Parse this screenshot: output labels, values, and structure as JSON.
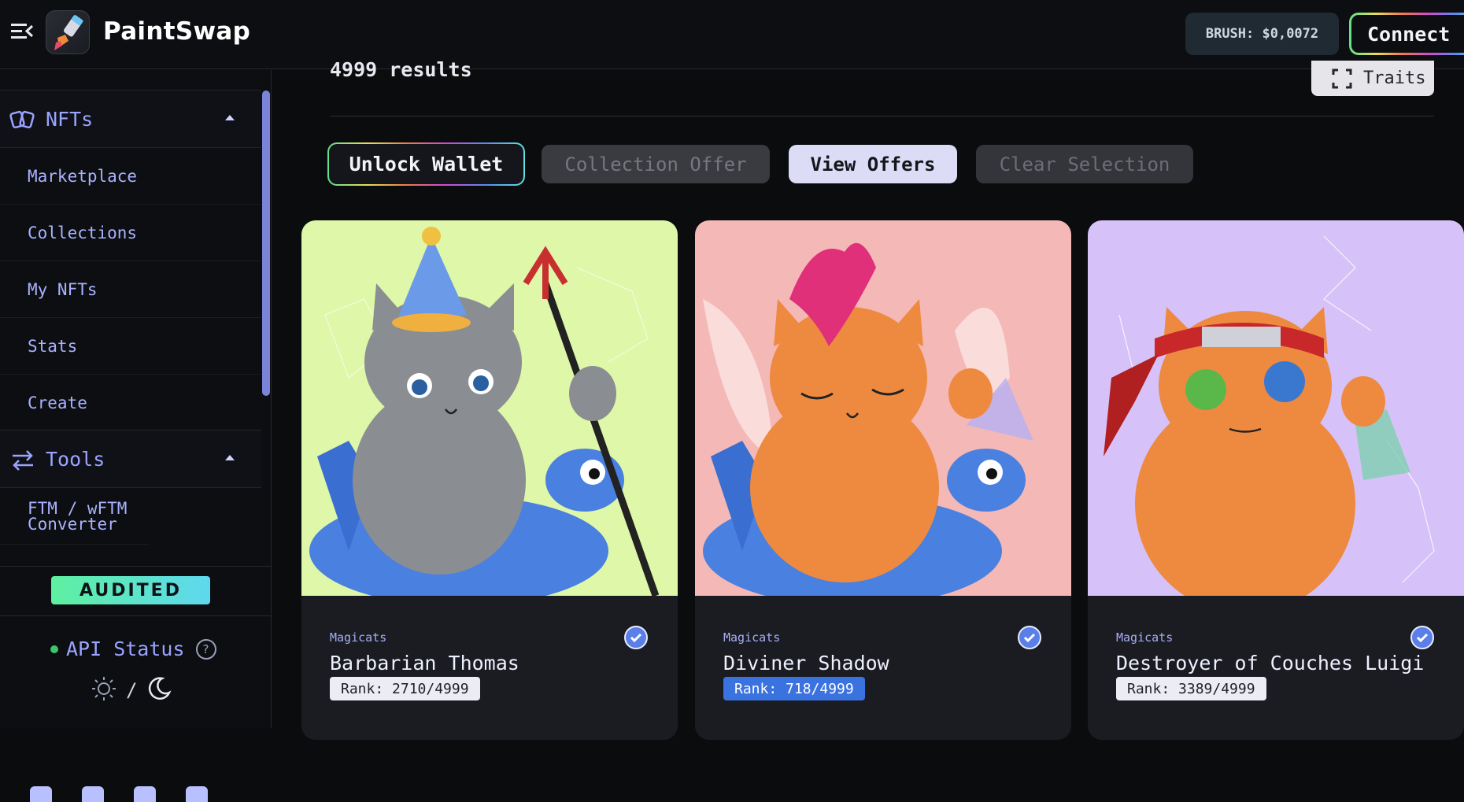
{
  "header": {
    "brand": "PaintSwap",
    "brush_price": "BRUSH: $0,0072",
    "connect_label": "Connect"
  },
  "sidebar": {
    "sections": [
      {
        "label": "NFTs",
        "icon": "cards-icon",
        "items": [
          {
            "label": "Marketplace"
          },
          {
            "label": "Collections"
          },
          {
            "label": "My NFTs"
          },
          {
            "label": "Stats"
          },
          {
            "label": "Create"
          }
        ]
      },
      {
        "label": "Tools",
        "icon": "swap-arrows-icon",
        "items": [
          {
            "label": "FTM / wFTM Converter"
          }
        ]
      }
    ],
    "audited_badge": "AUDITED",
    "api_status_label": "API Status",
    "theme_separator": "/",
    "api_status_color": "#3ec46d"
  },
  "main": {
    "results_text": "4999 results",
    "traits_button": "Traits",
    "actions": {
      "unlock_wallet": "Unlock Wallet",
      "collection_offer": "Collection Offer",
      "view_offers": "View Offers",
      "clear_selection": "Clear Selection"
    },
    "cards": [
      {
        "collection": "Magicats",
        "name": "Barbarian Thomas",
        "rank": "Rank: 2710/4999",
        "bg": "#dff7a8",
        "cat_color": "#8a8d92",
        "highlight_rank": false
      },
      {
        "collection": "Magicats",
        "name": "Diviner Shadow",
        "rank": "Rank: 718/4999",
        "bg": "#f4b8b6",
        "cat_color": "#ee8a40",
        "highlight_rank": true
      },
      {
        "collection": "Magicats",
        "name": "Destroyer of Couches Luigi",
        "rank": "Rank: 3389/4999",
        "bg": "#d6c2f8",
        "cat_color": "#ee8a40",
        "highlight_rank": false
      }
    ]
  },
  "colors": {
    "accent": "#9aa4ff",
    "rank_highlight": "#3a72e0"
  }
}
